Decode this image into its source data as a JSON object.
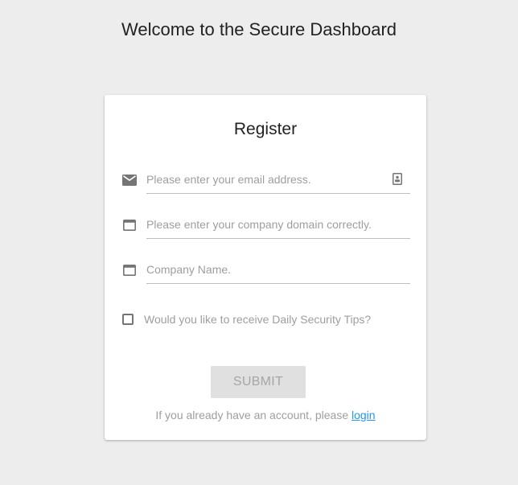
{
  "header": {
    "title": "Welcome to the Secure Dashboard"
  },
  "form": {
    "title": "Register",
    "fields": [
      {
        "name": "email",
        "placeholder": "Please enter your email address.",
        "value": "",
        "icon": "mail-icon"
      },
      {
        "name": "domain",
        "placeholder": "Please enter your company domain correctly.",
        "value": "",
        "icon": "web-icon"
      },
      {
        "name": "company",
        "placeholder": "Company Name.",
        "value": "",
        "icon": "web-icon"
      }
    ],
    "email_trailing_icon": "contact-card-icon",
    "checkbox": {
      "label": "Would you like to receive Daily Security Tips?",
      "checked": false
    },
    "submit_label": "SUBMIT",
    "login_prompt": "If you already have an account, please",
    "login_link": "login"
  },
  "colors": {
    "background": "#ededed",
    "card": "#ffffff",
    "link": "#2196f3",
    "disabled_button": "#e0e0e0"
  }
}
